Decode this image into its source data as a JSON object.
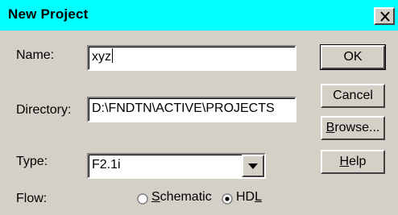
{
  "window": {
    "title": "New Project",
    "close_glyph": "X"
  },
  "form": {
    "name_label": "Name:",
    "name_value": "xyz",
    "directory_label": "Directory:",
    "directory_value": "D:\\FNDTN\\ACTIVE\\PROJECTS",
    "type_label": "Type:",
    "type_value": "F2.1i",
    "flow_label": "Flow:",
    "flow_options": [
      {
        "label_accel": "S",
        "label_rest": "chematic",
        "selected": false
      },
      {
        "label_prefix": "HD",
        "label_accel": "L",
        "selected": true
      }
    ]
  },
  "buttons": {
    "ok": "OK",
    "cancel": "Cancel",
    "browse_accel": "B",
    "browse_rest": "rowse...",
    "help_accel": "H",
    "help_rest": "elp"
  },
  "colors": {
    "titlebar": "#00ffff",
    "face": "#d4d0c8"
  }
}
